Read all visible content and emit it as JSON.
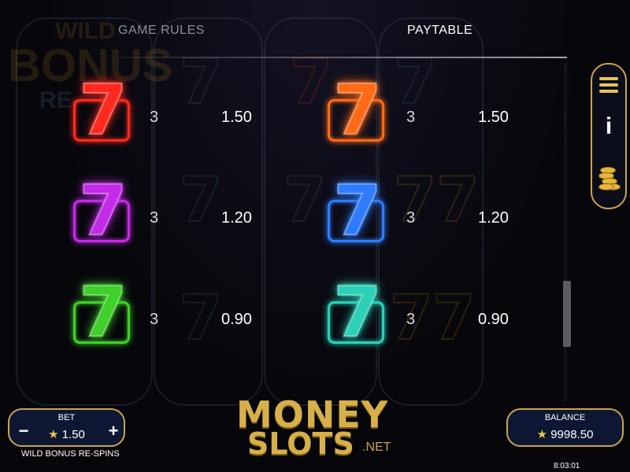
{
  "tabs": {
    "game_rules": "GAME RULES",
    "paytable": "PAYTABLE"
  },
  "background_text": {
    "wild": "WILD",
    "bonus": "BONUS",
    "respins": "RE-"
  },
  "paytable": {
    "rows": [
      {
        "left": {
          "symbol": "7",
          "color": "#ff2a1f",
          "count": "3",
          "payout": "1.50"
        },
        "right": {
          "symbol": "7",
          "color": "#ff6a17",
          "count": "3",
          "payout": "1.50"
        }
      },
      {
        "left": {
          "symbol": "7",
          "color": "#c42be8",
          "count": "3",
          "payout": "1.20"
        },
        "right": {
          "symbol": "7",
          "color": "#2f7cff",
          "count": "3",
          "payout": "1.20"
        }
      },
      {
        "left": {
          "symbol": "7",
          "color": "#3fd02a",
          "count": "3",
          "payout": "0.90"
        },
        "right": {
          "symbol": "7",
          "color": "#2ad1b7",
          "count": "3",
          "payout": "0.90"
        }
      }
    ]
  },
  "side_menu": {
    "menu_icon": "hamburger-icon",
    "info_icon": "info-icon",
    "info_glyph": "i",
    "coins_icon": "coins-icon"
  },
  "bet": {
    "title": "BET",
    "star": "★",
    "value": "1.50",
    "minus": "−",
    "plus": "+"
  },
  "balance": {
    "title": "BALANCE",
    "star": "★",
    "value": "9998.50"
  },
  "game_mode": "WILD BONUS RE-SPINS",
  "clock": "8:03:01",
  "logo": {
    "money": "MONEY",
    "slots": "SLOTS",
    "net": ".NET"
  },
  "colors": {
    "accent_gold": "#c9a64a",
    "panel_navy": "#0d1734"
  }
}
